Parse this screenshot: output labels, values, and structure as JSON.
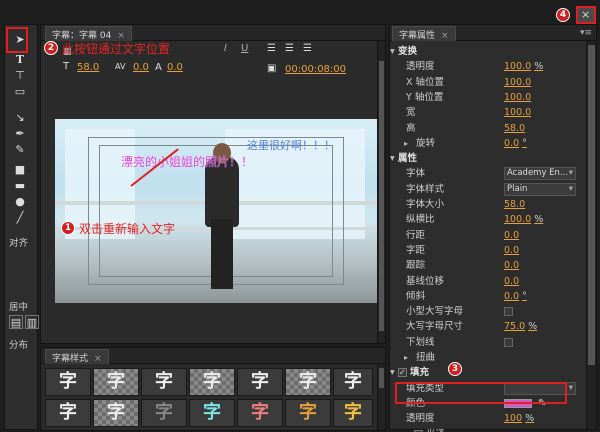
{
  "editor": {
    "tab_label": "字幕：字幕 04",
    "font_size": "58.0",
    "tracking": "0.0",
    "leading": "0.0",
    "timecode": "00:00:08:00",
    "text_pink": "漂亮的小姐姐的照片！！",
    "text_blue": "这里很好啊！！！"
  },
  "toolbox": {
    "align_label": "对齐",
    "center_label": "居中",
    "distribute_label": "分布"
  },
  "styles": {
    "tab_label": "字幕样式",
    "glyph": "字"
  },
  "props": {
    "tab_label": "字幕属性",
    "rows": [
      {
        "type": "section",
        "label": "变换"
      },
      {
        "label": "透明度",
        "value": "100.0",
        "unit": "%"
      },
      {
        "label": "X 轴位置",
        "value": "100.0"
      },
      {
        "label": "Y 轴位置",
        "value": "100.0"
      },
      {
        "label": "宽",
        "value": "100.0"
      },
      {
        "label": "高",
        "value": "58.0"
      },
      {
        "label": "旋转",
        "value": "0.0",
        "unit": "°",
        "sub": true
      },
      {
        "type": "section",
        "label": "属性"
      },
      {
        "label": "字体",
        "dropdown": "Academy En..."
      },
      {
        "label": "字体样式",
        "dropdown": "Plain"
      },
      {
        "label": "字体大小",
        "value": "58.0"
      },
      {
        "label": "纵横比",
        "value": "100.0",
        "unit": "%"
      },
      {
        "label": "行距",
        "value": "0.0"
      },
      {
        "label": "字距",
        "value": "0.0"
      },
      {
        "label": "跟踪",
        "value": "0.0"
      },
      {
        "label": "基线位移",
        "value": "0.0"
      },
      {
        "label": "倾斜",
        "value": "0.0",
        "unit": "°"
      },
      {
        "label": "小型大写字母",
        "checkbox": true
      },
      {
        "label": "大写字母尺寸",
        "value": "75.0",
        "unit": "%"
      },
      {
        "label": "下划线",
        "checkbox": true
      },
      {
        "label": "扭曲",
        "sub": true
      },
      {
        "type": "section",
        "label": "填充",
        "checked": true
      },
      {
        "label": "填充类型",
        "dropdown": ""
      },
      {
        "label": "颜色",
        "color": true
      },
      {
        "label": "透明度",
        "value": "100",
        "unit": "%"
      },
      {
        "label": "光泽",
        "sub": true,
        "checkbox_left": true
      }
    ]
  },
  "annotations": {
    "note1": "双击重新输入文字",
    "note2": "此按钮通过文字位置",
    "n1": "1",
    "n2": "2",
    "n3": "3",
    "n4": "4"
  },
  "colors": {
    "accent": "#e6a03c",
    "annotation": "#e02020",
    "fill_color": "#c85fc8",
    "title_pink": "#e040e0",
    "title_blue": "#5080d8"
  }
}
